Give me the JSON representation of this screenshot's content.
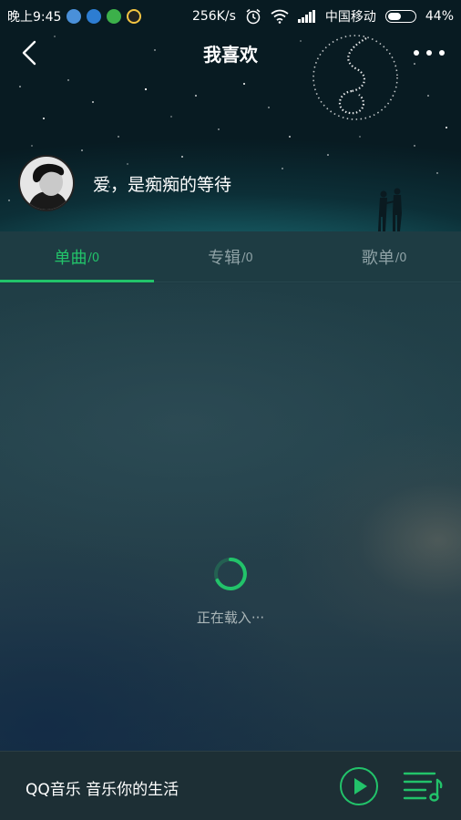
{
  "status_bar": {
    "time": "晚上9:45",
    "speed": "256K/s",
    "carrier": "中国移动",
    "battery": "44%"
  },
  "nav": {
    "title": "我喜欢"
  },
  "profile": {
    "name": "爱，是痴痴的等待"
  },
  "tabs": [
    {
      "label": "单曲",
      "count": "/0",
      "active": true
    },
    {
      "label": "专辑",
      "count": "/0",
      "active": false
    },
    {
      "label": "歌单",
      "count": "/0",
      "active": false
    }
  ],
  "main": {
    "loading_text": "正在载入···"
  },
  "player": {
    "text": "QQ音乐 音乐你的生活"
  },
  "colors": {
    "accent": "#22c36a"
  }
}
